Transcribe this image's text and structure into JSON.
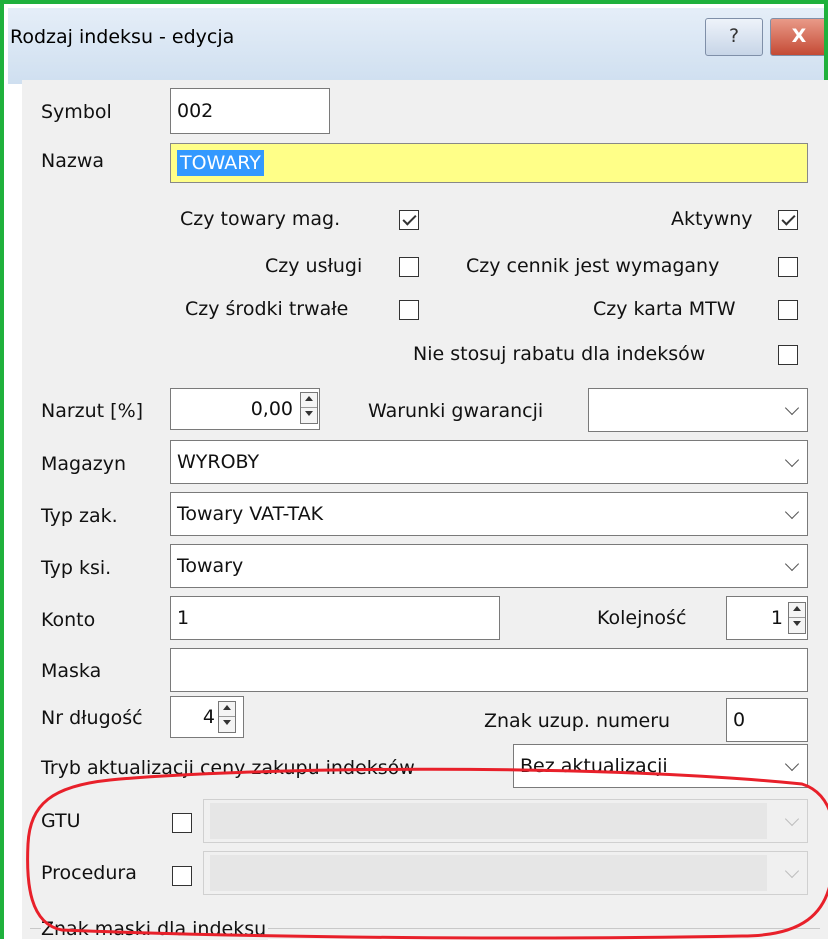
{
  "window": {
    "title": "Rodzaj indeksu - edycja",
    "help_label": "?",
    "close_label": "X"
  },
  "symbol": {
    "label": "Symbol",
    "value": "002"
  },
  "nazwa": {
    "label": "Nazwa",
    "value": "TOWARY"
  },
  "checks": {
    "towary_mag": {
      "label": "Czy towary mag.",
      "checked": true
    },
    "aktywny": {
      "label": "Aktywny",
      "checked": true
    },
    "uslugi": {
      "label": "Czy usługi",
      "checked": false
    },
    "cennik": {
      "label": "Czy cennik jest wymagany",
      "checked": false
    },
    "srodki": {
      "label": "Czy środki trwałe",
      "checked": false
    },
    "karta_mtw": {
      "label": "Czy karta MTW",
      "checked": false
    },
    "rabat": {
      "label": "Nie stosuj rabatu dla indeksów",
      "checked": false
    }
  },
  "narzut": {
    "label": "Narzut [%]",
    "value": "0,00"
  },
  "warunki": {
    "label": "Warunki gwarancji",
    "value": ""
  },
  "magazyn": {
    "label": "Magazyn",
    "value": "WYROBY"
  },
  "typ_zak": {
    "label": "Typ zak.",
    "value": "Towary VAT-TAK"
  },
  "typ_ksi": {
    "label": "Typ ksi.",
    "value": "Towary"
  },
  "konto": {
    "label": "Konto",
    "value": "1"
  },
  "kolejnosc": {
    "label": "Kolejność",
    "value": "1"
  },
  "maska": {
    "label": "Maska",
    "value": ""
  },
  "nr_dlugosc": {
    "label": "Nr długość",
    "value": "4"
  },
  "znak_uzup": {
    "label": "Znak uzup. numeru",
    "value": "0"
  },
  "tryb": {
    "label": "Tryb aktualizacji ceny zakupu indeksów",
    "value": "Bez aktualizacji"
  },
  "gtu": {
    "label": "GTU",
    "checked": false,
    "value": ""
  },
  "procedura": {
    "label": "Procedura",
    "checked": false,
    "value": ""
  },
  "znak_maski": {
    "label": "Znak maski dla indeksu"
  },
  "colors": {
    "frame_border": "#1fb13c",
    "highlight_bg": "#ffff88",
    "selection": "#3399ff",
    "annotation": "#e8202a"
  }
}
